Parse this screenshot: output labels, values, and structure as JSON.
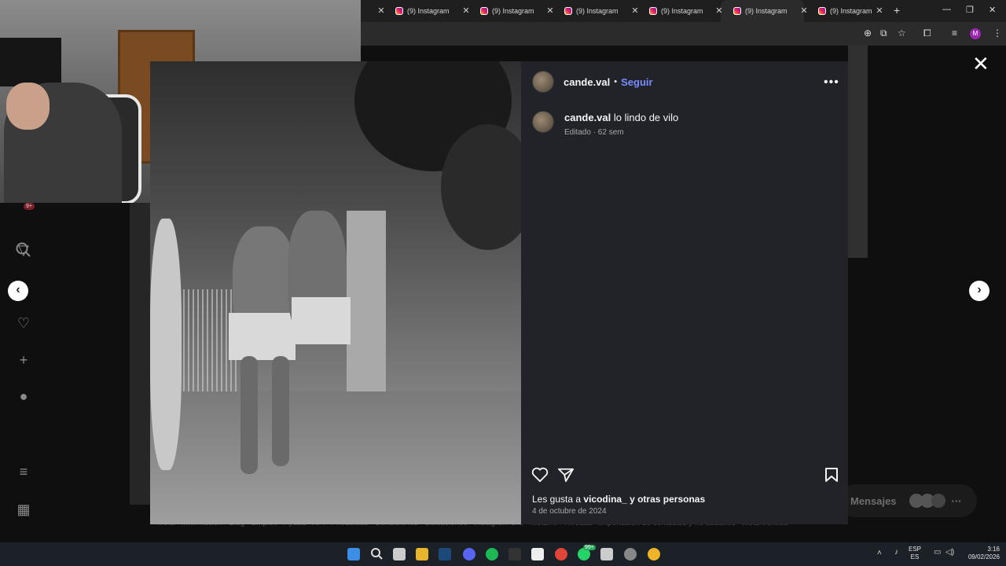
{
  "browser": {
    "tabs": [
      {
        "title": "(9) Instagram",
        "active": false
      },
      {
        "title": "(9) Instagram",
        "active": false
      },
      {
        "title": "(9) Instagram",
        "active": false
      },
      {
        "title": "(9) Instagram",
        "active": false
      },
      {
        "title": "(9) Instagram",
        "active": true
      },
      {
        "title": "(9) Instagram",
        "active": false
      }
    ],
    "profile_initial": "M"
  },
  "sidebar": {
    "notification_badge": "9+"
  },
  "post": {
    "username": "cande.val",
    "follow_label": "Seguir",
    "separator": "•",
    "caption_user": "cande.val",
    "caption_text": "lo lindo de vilo",
    "caption_meta": "Editado · 62 sem",
    "likes_prefix": "Les gusta a",
    "likes_user": "vicodina_",
    "likes_suffix": "y otras personas",
    "date": "4 de octubre de 2024"
  },
  "messages_widget": {
    "label": "Mensajes"
  },
  "footer": {
    "links": [
      "Meta",
      "Información",
      "Blog",
      "Empleo",
      "Ayuda",
      "API",
      "Privacidad",
      "Condiciones",
      "Ubicaciones",
      "Instagram Lite",
      "Meta AI",
      "Threads",
      "Importación de contactos y no usuarios",
      "Meta Verified"
    ]
  },
  "taskbar": {
    "lang_line1": "ESP",
    "lang_line2": "ES",
    "time": "3:16",
    "date": "09/02/2026",
    "whatsapp_badge": "99+"
  },
  "colors": {
    "follow_blue": "#7a8cff",
    "panel_bg": "#212328",
    "instagram_gradient": [
      "#f9a825",
      "#e91e63",
      "#7b1fa2"
    ]
  }
}
